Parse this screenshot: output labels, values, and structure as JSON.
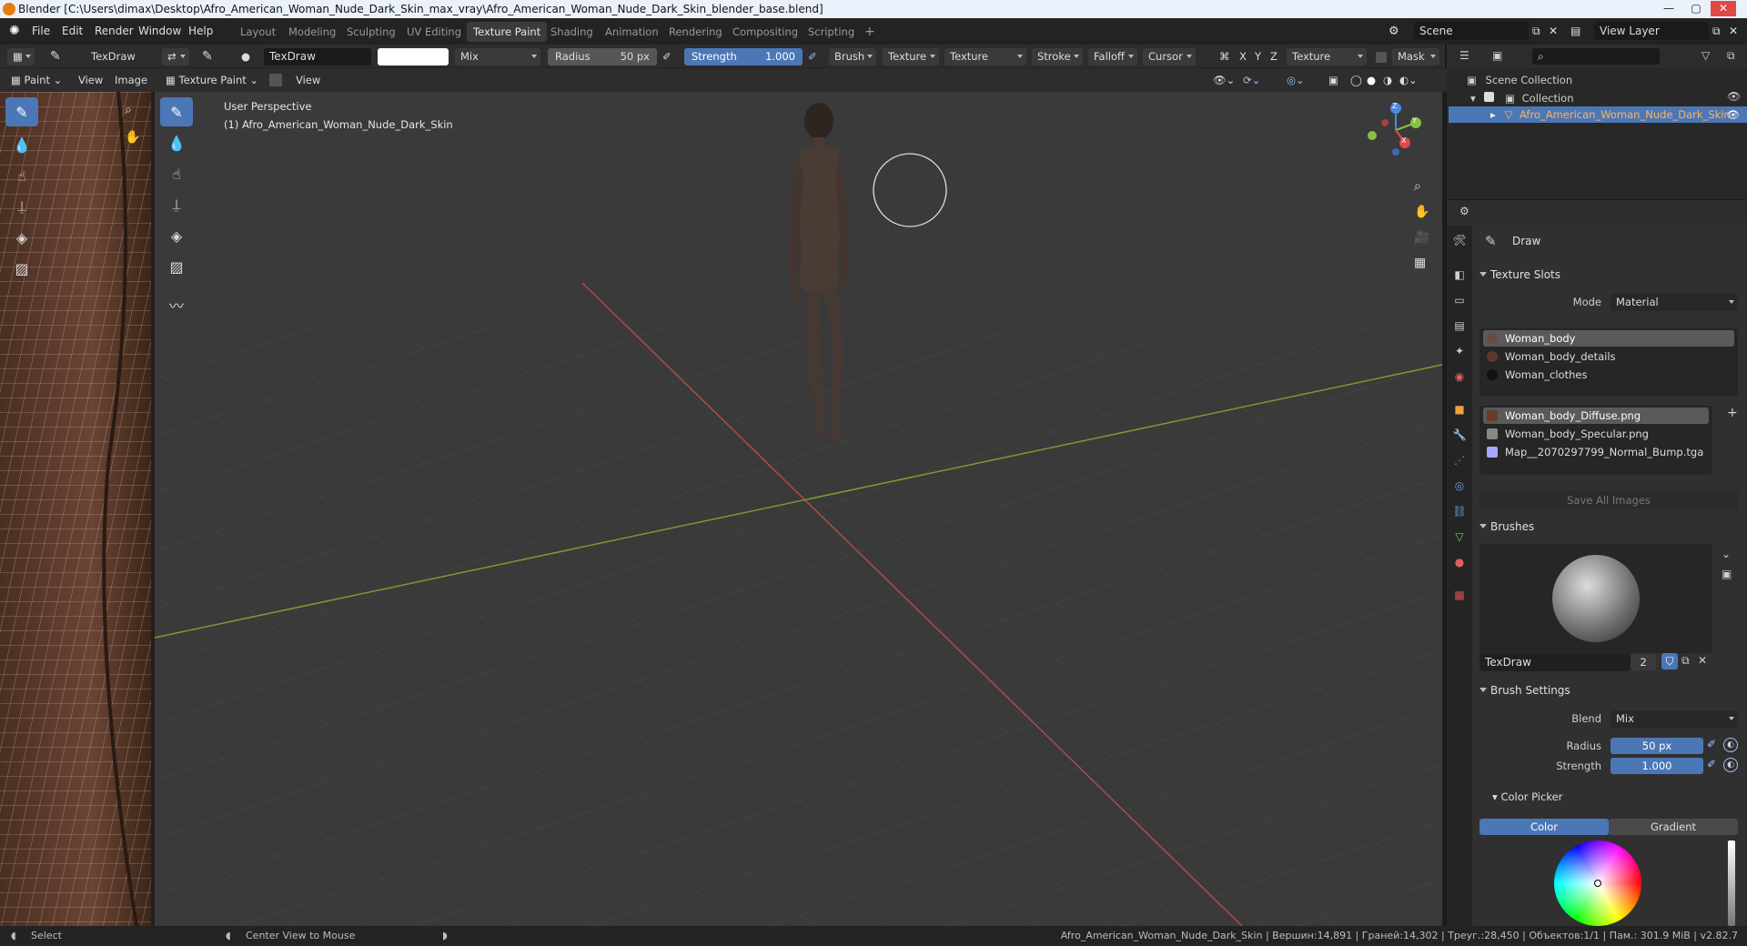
{
  "window": {
    "title": "Blender [C:\\Users\\dimax\\Desktop\\Afro_American_Woman_Nude_Dark_Skin_max_vray\\Afro_American_Woman_Nude_Dark_Skin_blender_base.blend]",
    "minimize": "—",
    "maximize": "▢",
    "close": "✕"
  },
  "menu": [
    "File",
    "Edit",
    "Render",
    "Window",
    "Help"
  ],
  "workspaces": [
    "Layout",
    "Modeling",
    "Sculpting",
    "UV Editing",
    "Texture Paint",
    "Shading",
    "Animation",
    "Rendering",
    "Compositing",
    "Scripting"
  ],
  "active_workspace": "Texture Paint",
  "add_workspace": "+",
  "scene": {
    "label": "Scene",
    "view_layer": "View Layer"
  },
  "tool_header": {
    "brush_short": "TexDraw",
    "brush_name": "TexDraw",
    "blend": "Mix",
    "radius_label": "Radius",
    "radius_value": "50 px",
    "strength_label": "Strength",
    "strength_value": "1.000",
    "menus": [
      "Brush",
      "Texture",
      "Texture Mask",
      "Stroke",
      "Falloff",
      "Cursor"
    ],
    "axes": [
      "X",
      "Y",
      "Z"
    ],
    "texture_slots": "Texture Slots",
    "mask": "Mask"
  },
  "image_editor_header": {
    "mode": "Paint",
    "view": "View",
    "image": "Image"
  },
  "viewport_header": {
    "mode": "Texture Paint",
    "view": "View"
  },
  "viewport": {
    "perspective": "User Perspective",
    "object_info": "(1) Afro_American_Woman_Nude_Dark_Skin",
    "gizmo": {
      "z": "Z",
      "y": "Y",
      "x": "X"
    }
  },
  "outliner": {
    "scene_collection": "Scene Collection",
    "collection": "Collection",
    "object": "Afro_American_Woman_Nude_Dark_Skin"
  },
  "properties": {
    "tool_name": "Draw",
    "texture_slots": {
      "title": "Texture Slots",
      "mode_label": "Mode",
      "mode_value": "Material",
      "materials": [
        "Woman_body",
        "Woman_body_details",
        "Woman_clothes"
      ],
      "images": [
        "Woman_body_Diffuse.png",
        "Woman_body_Specular.png",
        "Map__2070297799_Normal_Bump.tga"
      ],
      "save_all": "Save All Images"
    },
    "brushes": {
      "title": "Brushes",
      "name": "TexDraw",
      "users": "2"
    },
    "brush_settings": {
      "title": "Brush Settings",
      "blend_label": "Blend",
      "blend_value": "Mix",
      "radius_label": "Radius",
      "radius_value": "50 px",
      "strength_label": "Strength",
      "strength_value": "1.000",
      "color_picker": "Color Picker",
      "color_tab": "Color",
      "gradient_tab": "Gradient"
    }
  },
  "status": {
    "select": "Select",
    "center_view": "Center View to Mouse",
    "stats": "Afro_American_Woman_Nude_Dark_Skin | Вершин:14,891 | Граней:14,302 | Треуг.:28,450 | Объектов:1/1 | Пам.: 301.9 MiB | v2.82.7"
  },
  "colors": {
    "accent": "#4c77b6",
    "header": "#2d2d2d",
    "viewport_bg": "#393939",
    "x_axis": "#c84a4a",
    "y_axis": "#7ea33a"
  }
}
